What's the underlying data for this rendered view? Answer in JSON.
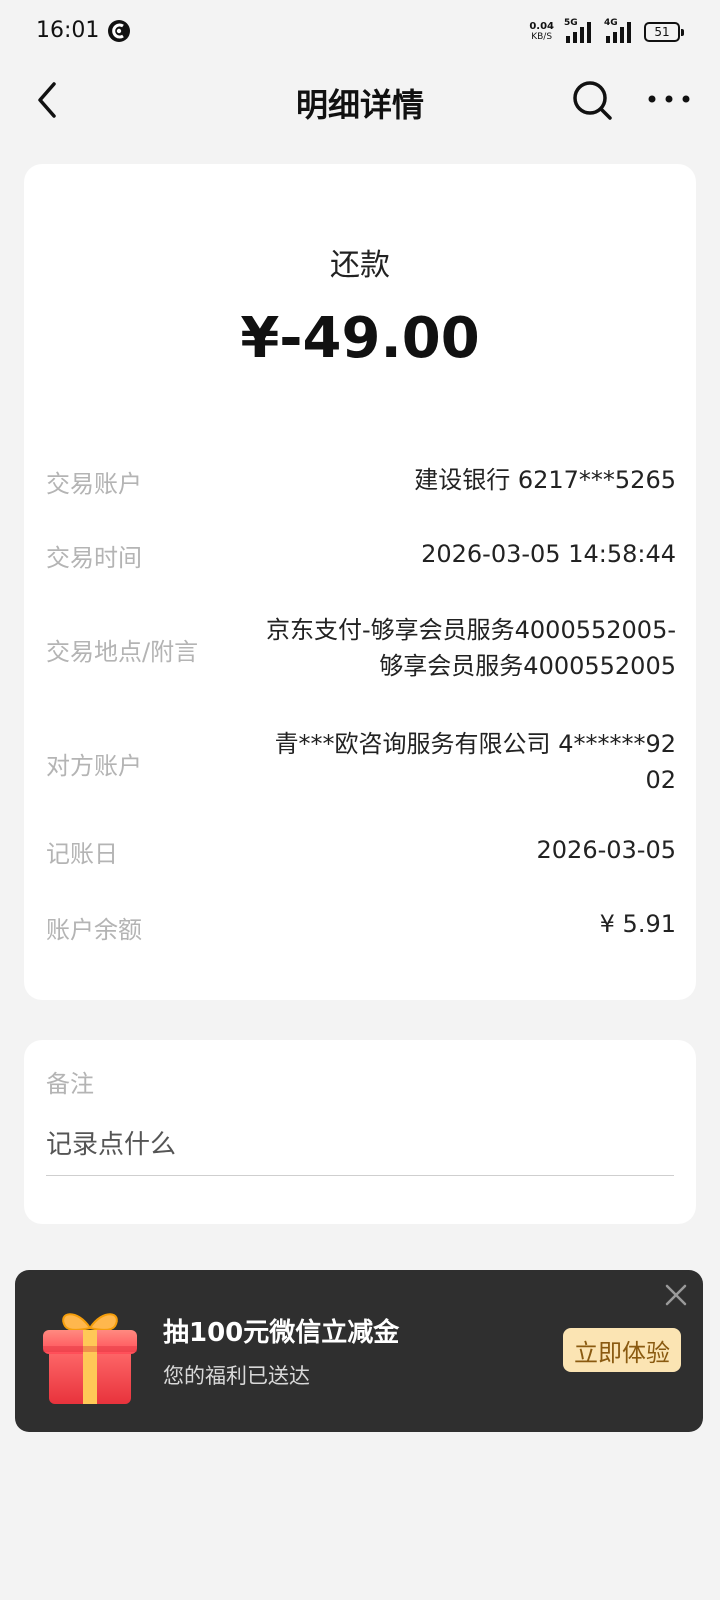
{
  "status_bar": {
    "time": "16:01",
    "net_speed_value": "0.04",
    "net_speed_unit": "KB/S",
    "signal1_tag": "5G",
    "signal2_tag": "4G",
    "battery": "51"
  },
  "header": {
    "title": "明细详情",
    "back_icon": "back-arrow-icon",
    "search_icon": "search-icon",
    "more_icon": "more-dots-icon"
  },
  "transaction": {
    "type": "还款",
    "amount": "¥-49.00",
    "rows": [
      {
        "label": "交易账户",
        "value": "建设银行 6217***5265"
      },
      {
        "label": "交易时间",
        "value": "2026-03-05 14:58:44"
      },
      {
        "label": "交易地点/附言",
        "value_line1": "京东支付-够享会员服务4000552005-",
        "value_line2": "够享会员服务4000552005"
      },
      {
        "label": "对方账户",
        "value_line1": "青***欧咨询服务有限公司 4******92",
        "value_line2": "02"
      },
      {
        "label": "记账日",
        "value": "2026-03-05"
      },
      {
        "label": "账户余额",
        "value": "¥ 5.91"
      }
    ]
  },
  "note": {
    "label": "备注",
    "placeholder": "记录点什么",
    "value": ""
  },
  "promo": {
    "title": "抽100元微信立减金",
    "subtitle": "您的福利已送达",
    "button_label": "立即体验",
    "close_icon": "close-icon",
    "gift_icon": "gift-box-icon",
    "button_color": "#fbe4b3",
    "background_color": "#2f2f2f"
  }
}
